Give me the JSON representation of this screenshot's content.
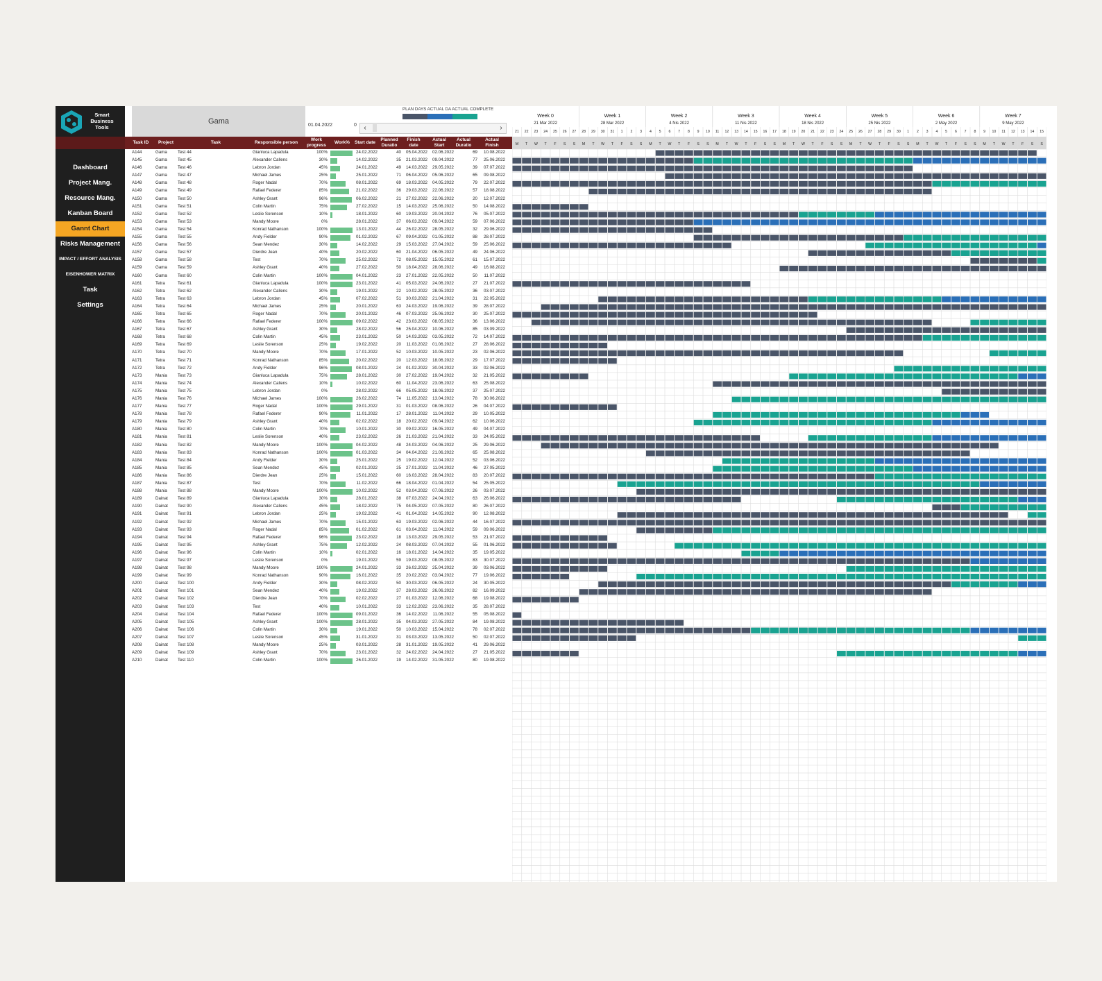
{
  "app": {
    "brand": [
      "Smart",
      "Business",
      "Tools"
    ],
    "project_title": "Gama",
    "date": "01.04.2022",
    "offset": "0"
  },
  "nav": [
    {
      "label": "Dashboard",
      "name": "nav-dashboard"
    },
    {
      "label": "Project Mang.",
      "name": "nav-project-mang"
    },
    {
      "label": "Resource Mang.",
      "name": "nav-resource-mang"
    },
    {
      "label": "Kanban Board",
      "name": "nav-kanban-board"
    },
    {
      "label": "Gannt Chart",
      "name": "nav-gannt-chart"
    },
    {
      "label": "Risks Management",
      "name": "nav-risks-management"
    },
    {
      "label": "IMPACT / EFFORT ANALYSIS",
      "name": "nav-impact-effort"
    },
    {
      "label": "EISENHOWER MATRIX",
      "name": "nav-eisenhower"
    },
    {
      "label": "Task",
      "name": "nav-task"
    },
    {
      "label": "Settings",
      "name": "nav-settings"
    }
  ],
  "legend": {
    "label": "PLAN DAYS ACTUAL DA ACTUAL COMPLETE",
    "colors": [
      "#4a5568",
      "#2a6fb8",
      "#19a391"
    ]
  },
  "columns": [
    "Task ID",
    "Project",
    "Task",
    "Responsible person",
    "Work progress",
    "Work%",
    "Start date",
    "Planned Duratio",
    "Finish date",
    "Actual Start",
    "Actual Duratio",
    "Actual Finish"
  ],
  "weeks": [
    {
      "label": "Week 0",
      "date": "21 Mar 2022"
    },
    {
      "label": "Week 1",
      "date": "28 Mar 2022"
    },
    {
      "label": "Week 2",
      "date": "4 Nis 2022"
    },
    {
      "label": "Week 3",
      "date": "11 Nis 2022"
    },
    {
      "label": "Week 4",
      "date": "18 Nis 2022"
    },
    {
      "label": "Week 5",
      "date": "25 Nis 2022"
    },
    {
      "label": "Week 6",
      "date": "2 May 2022"
    },
    {
      "label": "Week 7",
      "date": "9 May 2022"
    }
  ],
  "day_numbers": [
    "21",
    "22",
    "23",
    "24",
    "25",
    "26",
    "27",
    "28",
    "29",
    "30",
    "31",
    "1",
    "2",
    "3",
    "4",
    "5",
    "6",
    "7",
    "8",
    "9",
    "10",
    "11",
    "12",
    "13",
    "14",
    "15",
    "16",
    "17",
    "18",
    "19",
    "20",
    "21",
    "22",
    "23",
    "24",
    "25",
    "26",
    "27",
    "28",
    "29",
    "30",
    "1",
    "2",
    "3",
    "4",
    "5",
    "6",
    "7",
    "8",
    "9",
    "10",
    "11",
    "12",
    "13",
    "14",
    "15"
  ],
  "day_letters": [
    "M",
    "T",
    "W",
    "T",
    "F",
    "S",
    "S"
  ],
  "tasks": [
    [
      "A144",
      "Gama",
      "Test 44",
      "Gianluca Lapadula",
      "100%",
      "24.02.2022",
      "40",
      "05.04.2022",
      "02.06.2022",
      "69",
      "10.08.2022"
    ],
    [
      "A145",
      "Gama",
      "Test 45",
      "Alexander Callens",
      "30%",
      "14.02.2022",
      "35",
      "21.03.2022",
      "09.04.2022",
      "77",
      "25.06.2022"
    ],
    [
      "A146",
      "Gama",
      "Test 46",
      "Lebron Jordan",
      "45%",
      "24.01.2022",
      "49",
      "14.03.2022",
      "29.05.2022",
      "39",
      "07.07.2022"
    ],
    [
      "A147",
      "Gama",
      "Test 47",
      "Michael James",
      "25%",
      "25.01.2022",
      "71",
      "06.04.2022",
      "05.06.2022",
      "65",
      "09.08.2022"
    ],
    [
      "A148",
      "Gama",
      "Test 48",
      "Roger Nadal",
      "70%",
      "08.01.2022",
      "69",
      "18.03.2022",
      "04.05.2022",
      "79",
      "22.07.2022"
    ],
    [
      "A149",
      "Gama",
      "Test 49",
      "Rafael Federer",
      "85%",
      "21.02.2022",
      "36",
      "29.03.2022",
      "22.06.2022",
      "57",
      "18.08.2022"
    ],
    [
      "A150",
      "Gama",
      "Test 50",
      "Ashley Grant",
      "96%",
      "06.02.2022",
      "21",
      "27.02.2022",
      "22.06.2022",
      "20",
      "12.07.2022"
    ],
    [
      "A151",
      "Gama",
      "Test 51",
      "Colin Martin",
      "75%",
      "27.02.2022",
      "15",
      "14.03.2022",
      "25.06.2022",
      "50",
      "14.08.2022"
    ],
    [
      "A152",
      "Gama",
      "Test 52",
      "Leslie Sorenson",
      "10%",
      "18.01.2022",
      "60",
      "19.03.2022",
      "20.04.2022",
      "76",
      "05.07.2022"
    ],
    [
      "A153",
      "Gama",
      "Test 53",
      "Mandy Moore",
      "0%",
      "28.01.2022",
      "37",
      "06.03.2022",
      "09.04.2022",
      "59",
      "07.06.2022"
    ],
    [
      "A154",
      "Gama",
      "Test 54",
      "Konrad Nathanson",
      "100%",
      "13.01.2022",
      "44",
      "26.02.2022",
      "28.05.2022",
      "32",
      "29.06.2022"
    ],
    [
      "A155",
      "Gama",
      "Test 55",
      "Andy Fielder",
      "90%",
      "01.02.2022",
      "67",
      "09.04.2022",
      "01.05.2022",
      "88",
      "28.07.2022"
    ],
    [
      "A156",
      "Gama",
      "Test 56",
      "Sean Mendez",
      "30%",
      "14.02.2022",
      "29",
      "15.03.2022",
      "27.04.2022",
      "59",
      "25.06.2022"
    ],
    [
      "A157",
      "Gama",
      "Test 57",
      "Dierdre Jean",
      "40%",
      "20.02.2022",
      "60",
      "21.04.2022",
      "06.05.2022",
      "49",
      "24.06.2022"
    ],
    [
      "A158",
      "Gama",
      "Test 58",
      "Test",
      "70%",
      "25.02.2022",
      "72",
      "08.05.2022",
      "15.05.2022",
      "61",
      "15.07.2022"
    ],
    [
      "A159",
      "Gama",
      "Test 59",
      "Ashley Grant",
      "40%",
      "27.02.2022",
      "50",
      "18.04.2022",
      "28.06.2022",
      "49",
      "16.08.2022"
    ],
    [
      "A160",
      "Gama",
      "Test 60",
      "Colin Martin",
      "100%",
      "04.01.2022",
      "23",
      "27.01.2022",
      "22.05.2022",
      "50",
      "11.07.2022"
    ],
    [
      "A161",
      "Tetra",
      "Test 61",
      "Gianluca Lapadula",
      "100%",
      "23.01.2022",
      "41",
      "05.03.2022",
      "24.06.2022",
      "27",
      "21.07.2022"
    ],
    [
      "A162",
      "Tetra",
      "Test 62",
      "Alexander Callens",
      "30%",
      "19.01.2022",
      "22",
      "10.02.2022",
      "28.05.2022",
      "36",
      "03.07.2022"
    ],
    [
      "A163",
      "Tetra",
      "Test 63",
      "Lebron Jordan",
      "45%",
      "07.02.2022",
      "51",
      "30.03.2022",
      "21.04.2022",
      "31",
      "22.05.2022"
    ],
    [
      "A164",
      "Tetra",
      "Test 64",
      "Michael James",
      "25%",
      "20.01.2022",
      "63",
      "24.03.2022",
      "19.06.2022",
      "39",
      "28.07.2022"
    ],
    [
      "A165",
      "Tetra",
      "Test 65",
      "Roger Nadal",
      "70%",
      "20.01.2022",
      "46",
      "07.03.2022",
      "25.06.2022",
      "30",
      "25.07.2022"
    ],
    [
      "A166",
      "Tetra",
      "Test 66",
      "Rafael Federer",
      "100%",
      "09.02.2022",
      "42",
      "23.03.2022",
      "08.05.2022",
      "36",
      "13.06.2022"
    ],
    [
      "A167",
      "Tetra",
      "Test 67",
      "Ashley Grant",
      "30%",
      "28.02.2022",
      "56",
      "25.04.2022",
      "10.06.2022",
      "85",
      "03.09.2022"
    ],
    [
      "A168",
      "Tetra",
      "Test 68",
      "Colin Martin",
      "45%",
      "23.01.2022",
      "50",
      "14.03.2022",
      "03.05.2022",
      "72",
      "14.07.2022"
    ],
    [
      "A169",
      "Tetra",
      "Test 69",
      "Leslie Sorenson",
      "25%",
      "19.02.2022",
      "20",
      "11.03.2022",
      "01.06.2022",
      "27",
      "28.06.2022"
    ],
    [
      "A170",
      "Tetra",
      "Test 70",
      "Mandy Moore",
      "70%",
      "17.01.2022",
      "52",
      "10.03.2022",
      "10.05.2022",
      "23",
      "02.06.2022"
    ],
    [
      "A171",
      "Tetra",
      "Test 71",
      "Konrad Nathanson",
      "85%",
      "20.02.2022",
      "20",
      "12.03.2022",
      "18.06.2022",
      "29",
      "17.07.2022"
    ],
    [
      "A172",
      "Tetra",
      "Test 72",
      "Andy Fielder",
      "96%",
      "08.01.2022",
      "24",
      "01.02.2022",
      "30.04.2022",
      "33",
      "02.06.2022"
    ],
    [
      "A173",
      "Mania",
      "Test 73",
      "Gianluca Lapadula",
      "75%",
      "28.01.2022",
      "30",
      "27.02.2022",
      "19.04.2022",
      "32",
      "21.05.2022"
    ],
    [
      "A174",
      "Mania",
      "Test 74",
      "Alexander Callens",
      "10%",
      "10.02.2022",
      "60",
      "11.04.2022",
      "23.06.2022",
      "63",
      "25.08.2022"
    ],
    [
      "A175",
      "Mania",
      "Test 75",
      "Lebron Jordan",
      "0%",
      "28.02.2022",
      "66",
      "05.05.2022",
      "18.06.2022",
      "37",
      "25.07.2022"
    ],
    [
      "A176",
      "Mania",
      "Test 76",
      "Michael James",
      "100%",
      "26.02.2022",
      "74",
      "11.05.2022",
      "13.04.2022",
      "78",
      "30.06.2022"
    ],
    [
      "A177",
      "Mania",
      "Test 77",
      "Roger Nadal",
      "100%",
      "29.01.2022",
      "31",
      "01.03.2022",
      "08.06.2022",
      "26",
      "04.07.2022"
    ],
    [
      "A178",
      "Mania",
      "Test 78",
      "Rafael Federer",
      "90%",
      "11.01.2022",
      "17",
      "28.01.2022",
      "11.04.2022",
      "29",
      "10.05.2022"
    ],
    [
      "A179",
      "Mania",
      "Test 79",
      "Ashley Grant",
      "40%",
      "02.02.2022",
      "18",
      "20.02.2022",
      "09.04.2022",
      "62",
      "10.06.2022"
    ],
    [
      "A180",
      "Mania",
      "Test 80",
      "Colin Martin",
      "70%",
      "10.01.2022",
      "30",
      "09.02.2022",
      "16.05.2022",
      "49",
      "04.07.2022"
    ],
    [
      "A181",
      "Mania",
      "Test 81",
      "Leslie Sorenson",
      "40%",
      "23.02.2022",
      "26",
      "21.03.2022",
      "21.04.2022",
      "33",
      "24.05.2022"
    ],
    [
      "A182",
      "Mania",
      "Test 82",
      "Mandy Moore",
      "100%",
      "04.02.2022",
      "48",
      "24.03.2022",
      "04.06.2022",
      "25",
      "29.06.2022"
    ],
    [
      "A183",
      "Mania",
      "Test 83",
      "Konrad Nathanson",
      "100%",
      "01.03.2022",
      "34",
      "04.04.2022",
      "21.06.2022",
      "65",
      "25.08.2022"
    ],
    [
      "A184",
      "Mania",
      "Test 84",
      "Andy Fielder",
      "30%",
      "25.01.2022",
      "25",
      "19.02.2022",
      "12.04.2022",
      "52",
      "03.06.2022"
    ],
    [
      "A185",
      "Mania",
      "Test 85",
      "Sean Mendez",
      "45%",
      "02.01.2022",
      "25",
      "27.01.2022",
      "11.04.2022",
      "46",
      "27.05.2022"
    ],
    [
      "A186",
      "Mania",
      "Test 86",
      "Dierdre Jean",
      "25%",
      "15.01.2022",
      "60",
      "16.03.2022",
      "28.04.2022",
      "83",
      "20.07.2022"
    ],
    [
      "A187",
      "Mania",
      "Test 87",
      "Test",
      "70%",
      "11.02.2022",
      "66",
      "18.04.2022",
      "01.04.2022",
      "54",
      "25.05.2022"
    ],
    [
      "A188",
      "Mania",
      "Test 88",
      "Mandy Moore",
      "100%",
      "10.02.2022",
      "52",
      "03.04.2022",
      "07.06.2022",
      "26",
      "03.07.2022"
    ],
    [
      "A189",
      "Dainat",
      "Test 89",
      "Gianluca Lapadula",
      "30%",
      "28.01.2022",
      "38",
      "07.03.2022",
      "24.04.2022",
      "63",
      "26.06.2022"
    ],
    [
      "A190",
      "Dainat",
      "Test 90",
      "Alexander Callens",
      "45%",
      "18.02.2022",
      "75",
      "04.05.2022",
      "07.05.2022",
      "80",
      "26.07.2022"
    ],
    [
      "A191",
      "Dainat",
      "Test 91",
      "Lebron Jordan",
      "25%",
      "19.02.2022",
      "41",
      "01.04.2022",
      "14.05.2022",
      "90",
      "12.08.2022"
    ],
    [
      "A192",
      "Dainat",
      "Test 92",
      "Michael James",
      "70%",
      "15.01.2022",
      "63",
      "19.03.2022",
      "02.06.2022",
      "44",
      "16.07.2022"
    ],
    [
      "A193",
      "Dainat",
      "Test 93",
      "Roger Nadal",
      "85%",
      "01.02.2022",
      "61",
      "03.04.2022",
      "11.04.2022",
      "59",
      "09.06.2022"
    ],
    [
      "A194",
      "Dainat",
      "Test 94",
      "Rafael Federer",
      "96%",
      "23.02.2022",
      "18",
      "13.03.2022",
      "29.05.2022",
      "53",
      "21.07.2022"
    ],
    [
      "A195",
      "Dainat",
      "Test 95",
      "Ashley Grant",
      "75%",
      "12.02.2022",
      "24",
      "08.03.2022",
      "07.04.2022",
      "55",
      "01.06.2022"
    ],
    [
      "A196",
      "Dainat",
      "Test 96",
      "Colin Martin",
      "10%",
      "02.01.2022",
      "16",
      "18.01.2022",
      "14.04.2022",
      "35",
      "19.05.2022"
    ],
    [
      "A197",
      "Dainat",
      "Test 97",
      "Leslie Sorenson",
      "0%",
      "19.01.2022",
      "59",
      "19.03.2022",
      "08.05.2022",
      "83",
      "30.07.2022"
    ],
    [
      "A198",
      "Dainat",
      "Test 98",
      "Mandy Moore",
      "100%",
      "24.01.2022",
      "33",
      "26.02.2022",
      "25.04.2022",
      "39",
      "03.06.2022"
    ],
    [
      "A199",
      "Dainat",
      "Test 99",
      "Konrad Nathanson",
      "90%",
      "16.01.2022",
      "35",
      "20.02.2022",
      "03.04.2022",
      "77",
      "19.06.2022"
    ],
    [
      "A200",
      "Dainat",
      "Test 100",
      "Andy Fielder",
      "30%",
      "08.02.2022",
      "50",
      "30.03.2022",
      "06.05.2022",
      "24",
      "30.05.2022"
    ],
    [
      "A201",
      "Dainat",
      "Test 101",
      "Sean Mendez",
      "40%",
      "19.02.2022",
      "37",
      "28.03.2022",
      "26.06.2022",
      "82",
      "16.09.2022"
    ],
    [
      "A202",
      "Dainat",
      "Test 102",
      "Dierdre Jean",
      "70%",
      "02.02.2022",
      "27",
      "01.03.2022",
      "12.06.2022",
      "68",
      "19.08.2022"
    ],
    [
      "A203",
      "Dainat",
      "Test 103",
      "Test",
      "40%",
      "10.01.2022",
      "33",
      "12.02.2022",
      "23.06.2022",
      "35",
      "28.07.2022"
    ],
    [
      "A204",
      "Dainat",
      "Test 104",
      "Rafael Federer",
      "100%",
      "09.01.2022",
      "36",
      "14.02.2022",
      "11.06.2022",
      "55",
      "05.08.2022"
    ],
    [
      "A205",
      "Dainat",
      "Test 105",
      "Ashley Grant",
      "100%",
      "28.01.2022",
      "35",
      "04.03.2022",
      "27.05.2022",
      "84",
      "19.08.2022"
    ],
    [
      "A206",
      "Dainat",
      "Test 106",
      "Colin Martin",
      "30%",
      "19.01.2022",
      "50",
      "10.03.2022",
      "15.04.2022",
      "78",
      "02.07.2022"
    ],
    [
      "A207",
      "Dainat",
      "Test 107",
      "Leslie Sorenson",
      "45%",
      "31.01.2022",
      "31",
      "03.03.2022",
      "13.05.2022",
      "50",
      "02.07.2022"
    ],
    [
      "A208",
      "Dainat",
      "Test 108",
      "Mandy Moore",
      "25%",
      "03.01.2022",
      "28",
      "31.01.2022",
      "19.05.2022",
      "41",
      "29.06.2022"
    ],
    [
      "A209",
      "Dainat",
      "Test 109",
      "Ashley Grant",
      "70%",
      "23.01.2022",
      "32",
      "24.02.2022",
      "24.04.2022",
      "27",
      "21.05.2022"
    ],
    [
      "A210",
      "Dainat",
      "Test 110",
      "Colin Martin",
      "100%",
      "26.01.2022",
      "19",
      "14.02.2022",
      "31.05.2022",
      "80",
      "19.08.2022"
    ]
  ]
}
